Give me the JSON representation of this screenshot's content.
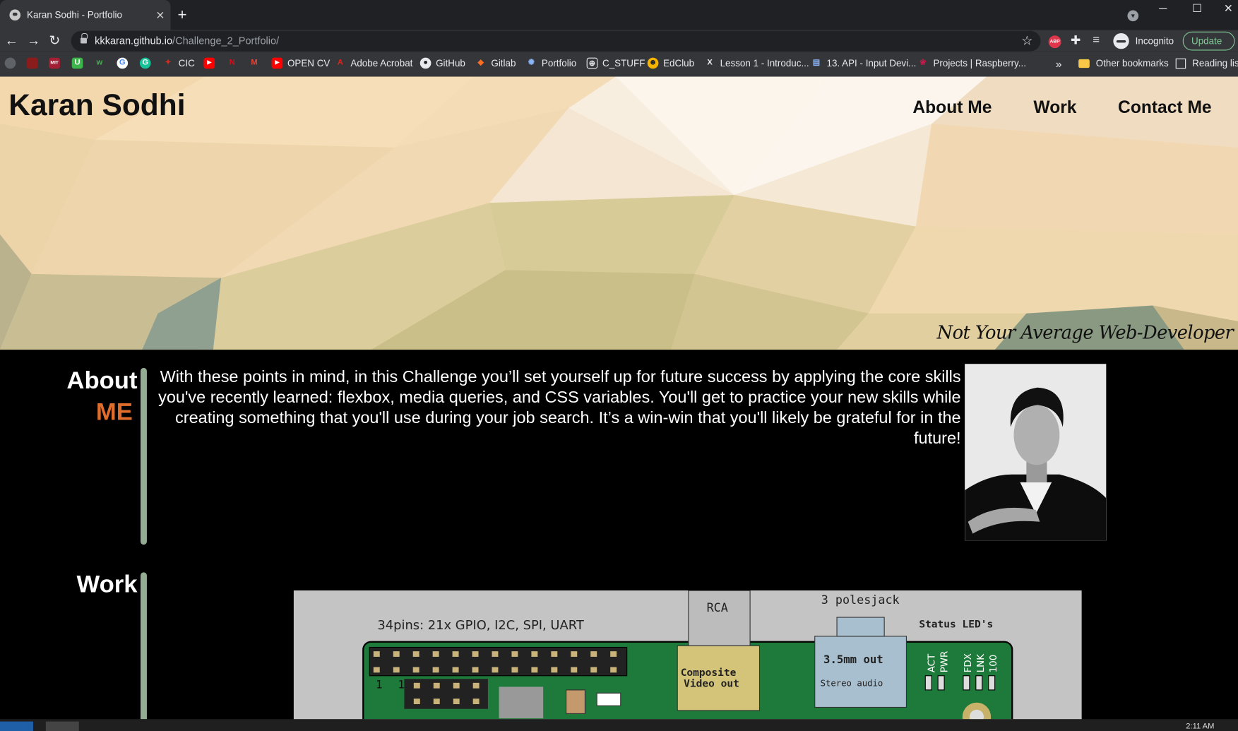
{
  "browser": {
    "tab_title": "Karan Sodhi - Portfolio",
    "url_host": "kkkaran.github.io",
    "url_path": "/Challenge_2_Portfolio/",
    "incognito_label": "Incognito",
    "update_label": "Update",
    "bookmarks": {
      "cic": "CIC",
      "opencv": "OPEN CV",
      "acrobat": "Adobe Acrobat",
      "github": "GitHub",
      "gitlab": "Gitlab",
      "portfolio": "Portfolio",
      "cstuff": "C_STUFF",
      "edclub": "EdClub",
      "lesson": "Lesson 1 - Introduc...",
      "api": "13. API - Input Devi...",
      "projects": "Projects | Raspberry...",
      "more": "»",
      "other": "Other bookmarks",
      "reading": "Reading list"
    }
  },
  "header": {
    "site_title": "Karan Sodhi",
    "nav": {
      "about": "About Me",
      "work": "Work",
      "contact": "Contact Me"
    },
    "tagline": "Not Your Average Web-Developer"
  },
  "about": {
    "heading_1": "About",
    "heading_2": "ME",
    "text": "With these points in mind, in this Challenge you’ll set yourself up for future success by applying the core skills you've recently learned: flexbox, media queries, and CSS variables. You'll get to practice your new skills while creating something that you'll use during your job search. It’s a win-win that you'll likely be grateful for in the future!"
  },
  "work": {
    "heading": "Work",
    "board_labels": {
      "rca": "RCA",
      "jack": "3 polesjack",
      "gpio": "34pins: 21x GPIO, I2C, SPI, UART",
      "status": "Status LED's",
      "composite_1": "Composite",
      "composite_2": "Video out",
      "audio_1": "3.5mm out",
      "audio_2": "Stereo audio",
      "leds": [
        "ACT",
        "PWR",
        "FDX",
        "LNK",
        "100"
      ],
      "pin_1": "1",
      "pin_2": "1"
    }
  },
  "taskbar": {
    "clock": "2:11 AM"
  },
  "colors": {
    "accent": "#e06d2b",
    "bar": "#94ab94",
    "chrome_dark": "#202124",
    "chrome": "#35363a"
  }
}
